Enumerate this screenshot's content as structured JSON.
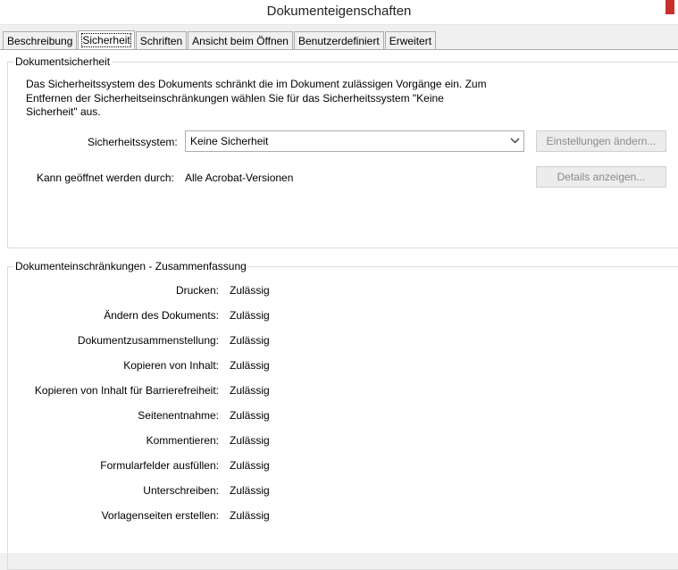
{
  "window": {
    "title": "Dokumenteigenschaften"
  },
  "tabs": [
    {
      "label": "Beschreibung"
    },
    {
      "label": "Sicherheit"
    },
    {
      "label": "Schriften"
    },
    {
      "label": "Ansicht beim Öffnen"
    },
    {
      "label": "Benutzerdefiniert"
    },
    {
      "label": "Erweitert"
    }
  ],
  "security": {
    "legend": "Dokumentsicherheit",
    "description": "Das Sicherheitssystem des Dokuments schränkt die im Dokument zulässigen Vorgänge ein. Zum Entfernen der Sicherheitseinschränkungen wählen Sie für das Sicherheitssystem \"Keine Sicherheit\" aus.",
    "system_label": "Sicherheitssystem:",
    "system_value": "Keine Sicherheit",
    "settings_button": "Einstellungen ändern...",
    "openable_label": "Kann geöffnet werden durch:",
    "openable_value": "Alle Acrobat-Versionen",
    "details_button": "Details anzeigen..."
  },
  "restrictions": {
    "legend": "Dokumenteinschränkungen - Zusammenfassung",
    "rows": [
      {
        "label": "Drucken:",
        "value": "Zulässig"
      },
      {
        "label": "Ändern des Dokuments:",
        "value": "Zulässig"
      },
      {
        "label": "Dokumentzusammenstellung:",
        "value": "Zulässig"
      },
      {
        "label": "Kopieren von Inhalt:",
        "value": "Zulässig"
      },
      {
        "label": "Kopieren von Inhalt für Barrierefreiheit:",
        "value": "Zulässig"
      },
      {
        "label": "Seitenentnahme:",
        "value": "Zulässig"
      },
      {
        "label": "Kommentieren:",
        "value": "Zulässig"
      },
      {
        "label": "Formularfelder ausfüllen:",
        "value": "Zulässig"
      },
      {
        "label": "Unterschreiben:",
        "value": "Zulässig"
      },
      {
        "label": "Vorlagenseiten erstellen:",
        "value": "Zulässig"
      }
    ]
  },
  "colors": {
    "close_button": "#c8302c",
    "disabled_text": "#8a8a8a"
  }
}
